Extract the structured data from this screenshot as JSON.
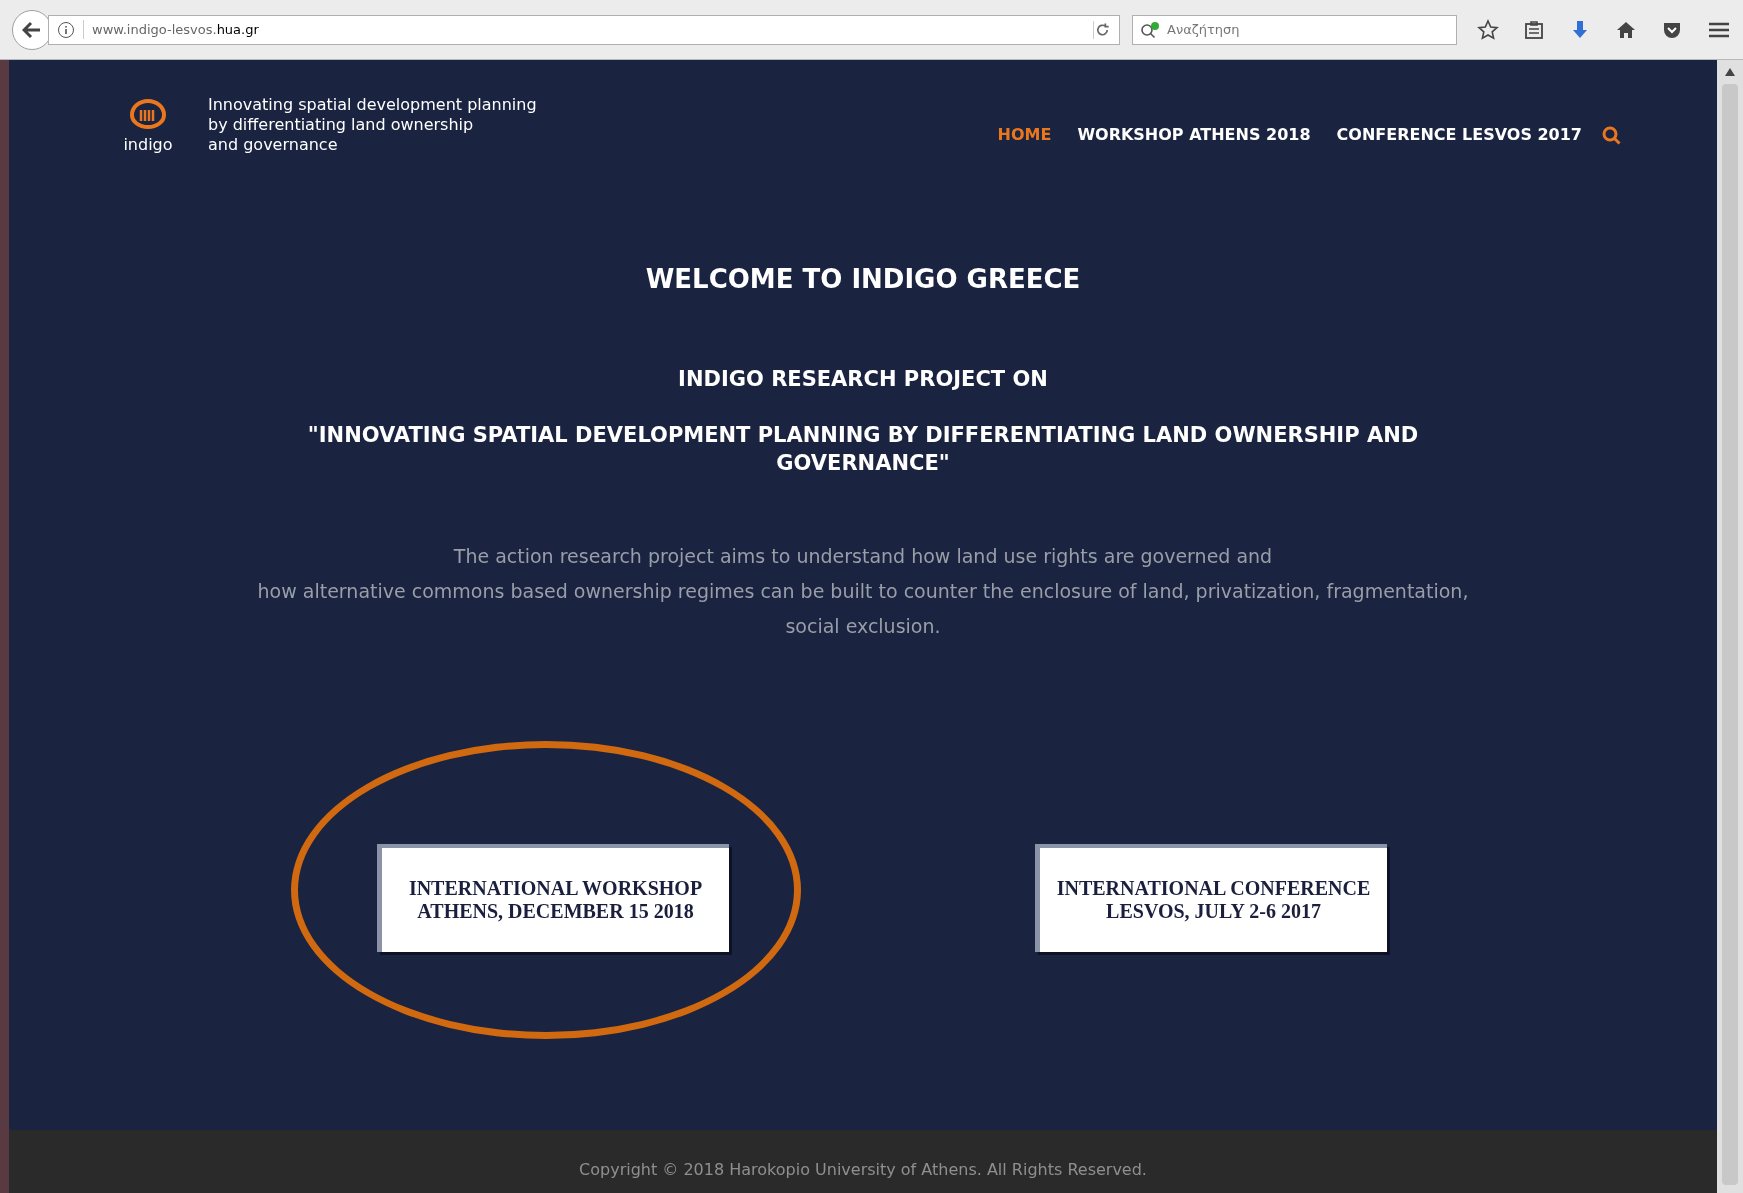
{
  "browser": {
    "url_prefix": "www.indigo-lesvos.",
    "url_domain": "hua.gr",
    "search_placeholder": "Αναζήτηση"
  },
  "header": {
    "logo_text": "indigo",
    "tagline": [
      "Innovating spatial development planning",
      "by differentiating land ownership",
      "and governance"
    ],
    "nav": [
      {
        "label": "HOME",
        "selected": true
      },
      {
        "label": "WORKSHOP ATHENS 2018",
        "selected": false
      },
      {
        "label": "CONFERENCE LESVOS 2017",
        "selected": false
      }
    ]
  },
  "main": {
    "title": "WELCOME TO INDIGO GREECE",
    "subtitle": "INDIGO RESEARCH PROJECT ON",
    "quote": "\"INNOVATING SPATIAL DEVELOPMENT PLANNING BY DIFFERENTIATING LAND OWNERSHIP AND GOVERNANCE\"",
    "paragraph": [
      "The action research project aims to understand how land use rights are governed and",
      "how alternative commons based ownership regimes can be built to counter the enclosure of land, privatization, fragmentation,",
      "social exclusion."
    ],
    "buttons": [
      {
        "lines": [
          "INTERNATIONAL WORKSHOP",
          "ATHENS, DECEMBER 15 2018"
        ],
        "circled": true
      },
      {
        "lines": [
          "INTERNATIONAL CONFERENCE",
          "LESVOS, JULY 2-6 2017"
        ],
        "circled": false
      }
    ]
  },
  "footer": {
    "text": "Copyright © 2018 Harokopio University of Athens. All Rights Reserved."
  }
}
